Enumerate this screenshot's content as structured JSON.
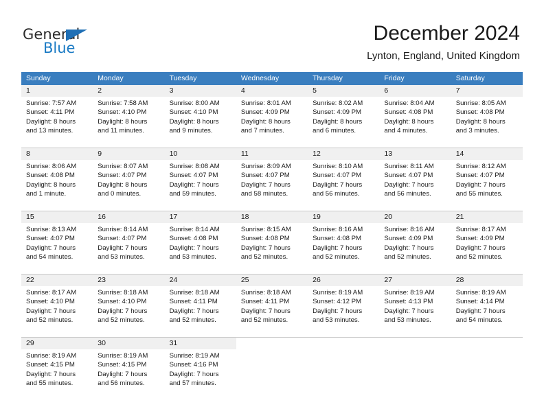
{
  "brand": {
    "name_top": "General",
    "name_bottom": "Blue",
    "color_blue": "#1a7ac4",
    "color_triangle": "#1f6fb5",
    "color_dark": "#2b2b2b"
  },
  "header": {
    "month_title": "December 2024",
    "location": "Lynton, England, United Kingdom"
  },
  "theme": {
    "header_row_bg": "#3a7ebf",
    "header_row_text": "#ffffff",
    "daynum_bg": "#f0f0f0",
    "cell_bg": "#ffffff",
    "grid_line": "#c8c8c8"
  },
  "weekdays": [
    "Sunday",
    "Monday",
    "Tuesday",
    "Wednesday",
    "Thursday",
    "Friday",
    "Saturday"
  ],
  "weeks": [
    [
      {
        "day": "1",
        "sunrise": "Sunrise: 7:57 AM",
        "sunset": "Sunset: 4:11 PM",
        "daylight_1": "Daylight: 8 hours",
        "daylight_2": "and 13 minutes."
      },
      {
        "day": "2",
        "sunrise": "Sunrise: 7:58 AM",
        "sunset": "Sunset: 4:10 PM",
        "daylight_1": "Daylight: 8 hours",
        "daylight_2": "and 11 minutes."
      },
      {
        "day": "3",
        "sunrise": "Sunrise: 8:00 AM",
        "sunset": "Sunset: 4:10 PM",
        "daylight_1": "Daylight: 8 hours",
        "daylight_2": "and 9 minutes."
      },
      {
        "day": "4",
        "sunrise": "Sunrise: 8:01 AM",
        "sunset": "Sunset: 4:09 PM",
        "daylight_1": "Daylight: 8 hours",
        "daylight_2": "and 7 minutes."
      },
      {
        "day": "5",
        "sunrise": "Sunrise: 8:02 AM",
        "sunset": "Sunset: 4:09 PM",
        "daylight_1": "Daylight: 8 hours",
        "daylight_2": "and 6 minutes."
      },
      {
        "day": "6",
        "sunrise": "Sunrise: 8:04 AM",
        "sunset": "Sunset: 4:08 PM",
        "daylight_1": "Daylight: 8 hours",
        "daylight_2": "and 4 minutes."
      },
      {
        "day": "7",
        "sunrise": "Sunrise: 8:05 AM",
        "sunset": "Sunset: 4:08 PM",
        "daylight_1": "Daylight: 8 hours",
        "daylight_2": "and 3 minutes."
      }
    ],
    [
      {
        "day": "8",
        "sunrise": "Sunrise: 8:06 AM",
        "sunset": "Sunset: 4:08 PM",
        "daylight_1": "Daylight: 8 hours",
        "daylight_2": "and 1 minute."
      },
      {
        "day": "9",
        "sunrise": "Sunrise: 8:07 AM",
        "sunset": "Sunset: 4:07 PM",
        "daylight_1": "Daylight: 8 hours",
        "daylight_2": "and 0 minutes."
      },
      {
        "day": "10",
        "sunrise": "Sunrise: 8:08 AM",
        "sunset": "Sunset: 4:07 PM",
        "daylight_1": "Daylight: 7 hours",
        "daylight_2": "and 59 minutes."
      },
      {
        "day": "11",
        "sunrise": "Sunrise: 8:09 AM",
        "sunset": "Sunset: 4:07 PM",
        "daylight_1": "Daylight: 7 hours",
        "daylight_2": "and 58 minutes."
      },
      {
        "day": "12",
        "sunrise": "Sunrise: 8:10 AM",
        "sunset": "Sunset: 4:07 PM",
        "daylight_1": "Daylight: 7 hours",
        "daylight_2": "and 56 minutes."
      },
      {
        "day": "13",
        "sunrise": "Sunrise: 8:11 AM",
        "sunset": "Sunset: 4:07 PM",
        "daylight_1": "Daylight: 7 hours",
        "daylight_2": "and 56 minutes."
      },
      {
        "day": "14",
        "sunrise": "Sunrise: 8:12 AM",
        "sunset": "Sunset: 4:07 PM",
        "daylight_1": "Daylight: 7 hours",
        "daylight_2": "and 55 minutes."
      }
    ],
    [
      {
        "day": "15",
        "sunrise": "Sunrise: 8:13 AM",
        "sunset": "Sunset: 4:07 PM",
        "daylight_1": "Daylight: 7 hours",
        "daylight_2": "and 54 minutes."
      },
      {
        "day": "16",
        "sunrise": "Sunrise: 8:14 AM",
        "sunset": "Sunset: 4:07 PM",
        "daylight_1": "Daylight: 7 hours",
        "daylight_2": "and 53 minutes."
      },
      {
        "day": "17",
        "sunrise": "Sunrise: 8:14 AM",
        "sunset": "Sunset: 4:08 PM",
        "daylight_1": "Daylight: 7 hours",
        "daylight_2": "and 53 minutes."
      },
      {
        "day": "18",
        "sunrise": "Sunrise: 8:15 AM",
        "sunset": "Sunset: 4:08 PM",
        "daylight_1": "Daylight: 7 hours",
        "daylight_2": "and 52 minutes."
      },
      {
        "day": "19",
        "sunrise": "Sunrise: 8:16 AM",
        "sunset": "Sunset: 4:08 PM",
        "daylight_1": "Daylight: 7 hours",
        "daylight_2": "and 52 minutes."
      },
      {
        "day": "20",
        "sunrise": "Sunrise: 8:16 AM",
        "sunset": "Sunset: 4:09 PM",
        "daylight_1": "Daylight: 7 hours",
        "daylight_2": "and 52 minutes."
      },
      {
        "day": "21",
        "sunrise": "Sunrise: 8:17 AM",
        "sunset": "Sunset: 4:09 PM",
        "daylight_1": "Daylight: 7 hours",
        "daylight_2": "and 52 minutes."
      }
    ],
    [
      {
        "day": "22",
        "sunrise": "Sunrise: 8:17 AM",
        "sunset": "Sunset: 4:10 PM",
        "daylight_1": "Daylight: 7 hours",
        "daylight_2": "and 52 minutes."
      },
      {
        "day": "23",
        "sunrise": "Sunrise: 8:18 AM",
        "sunset": "Sunset: 4:10 PM",
        "daylight_1": "Daylight: 7 hours",
        "daylight_2": "and 52 minutes."
      },
      {
        "day": "24",
        "sunrise": "Sunrise: 8:18 AM",
        "sunset": "Sunset: 4:11 PM",
        "daylight_1": "Daylight: 7 hours",
        "daylight_2": "and 52 minutes."
      },
      {
        "day": "25",
        "sunrise": "Sunrise: 8:18 AM",
        "sunset": "Sunset: 4:11 PM",
        "daylight_1": "Daylight: 7 hours",
        "daylight_2": "and 52 minutes."
      },
      {
        "day": "26",
        "sunrise": "Sunrise: 8:19 AM",
        "sunset": "Sunset: 4:12 PM",
        "daylight_1": "Daylight: 7 hours",
        "daylight_2": "and 53 minutes."
      },
      {
        "day": "27",
        "sunrise": "Sunrise: 8:19 AM",
        "sunset": "Sunset: 4:13 PM",
        "daylight_1": "Daylight: 7 hours",
        "daylight_2": "and 53 minutes."
      },
      {
        "day": "28",
        "sunrise": "Sunrise: 8:19 AM",
        "sunset": "Sunset: 4:14 PM",
        "daylight_1": "Daylight: 7 hours",
        "daylight_2": "and 54 minutes."
      }
    ],
    [
      {
        "day": "29",
        "sunrise": "Sunrise: 8:19 AM",
        "sunset": "Sunset: 4:15 PM",
        "daylight_1": "Daylight: 7 hours",
        "daylight_2": "and 55 minutes."
      },
      {
        "day": "30",
        "sunrise": "Sunrise: 8:19 AM",
        "sunset": "Sunset: 4:15 PM",
        "daylight_1": "Daylight: 7 hours",
        "daylight_2": "and 56 minutes."
      },
      {
        "day": "31",
        "sunrise": "Sunrise: 8:19 AM",
        "sunset": "Sunset: 4:16 PM",
        "daylight_1": "Daylight: 7 hours",
        "daylight_2": "and 57 minutes."
      },
      {
        "day": "",
        "sunrise": "",
        "sunset": "",
        "daylight_1": "",
        "daylight_2": ""
      },
      {
        "day": "",
        "sunrise": "",
        "sunset": "",
        "daylight_1": "",
        "daylight_2": ""
      },
      {
        "day": "",
        "sunrise": "",
        "sunset": "",
        "daylight_1": "",
        "daylight_2": ""
      },
      {
        "day": "",
        "sunrise": "",
        "sunset": "",
        "daylight_1": "",
        "daylight_2": ""
      }
    ]
  ]
}
